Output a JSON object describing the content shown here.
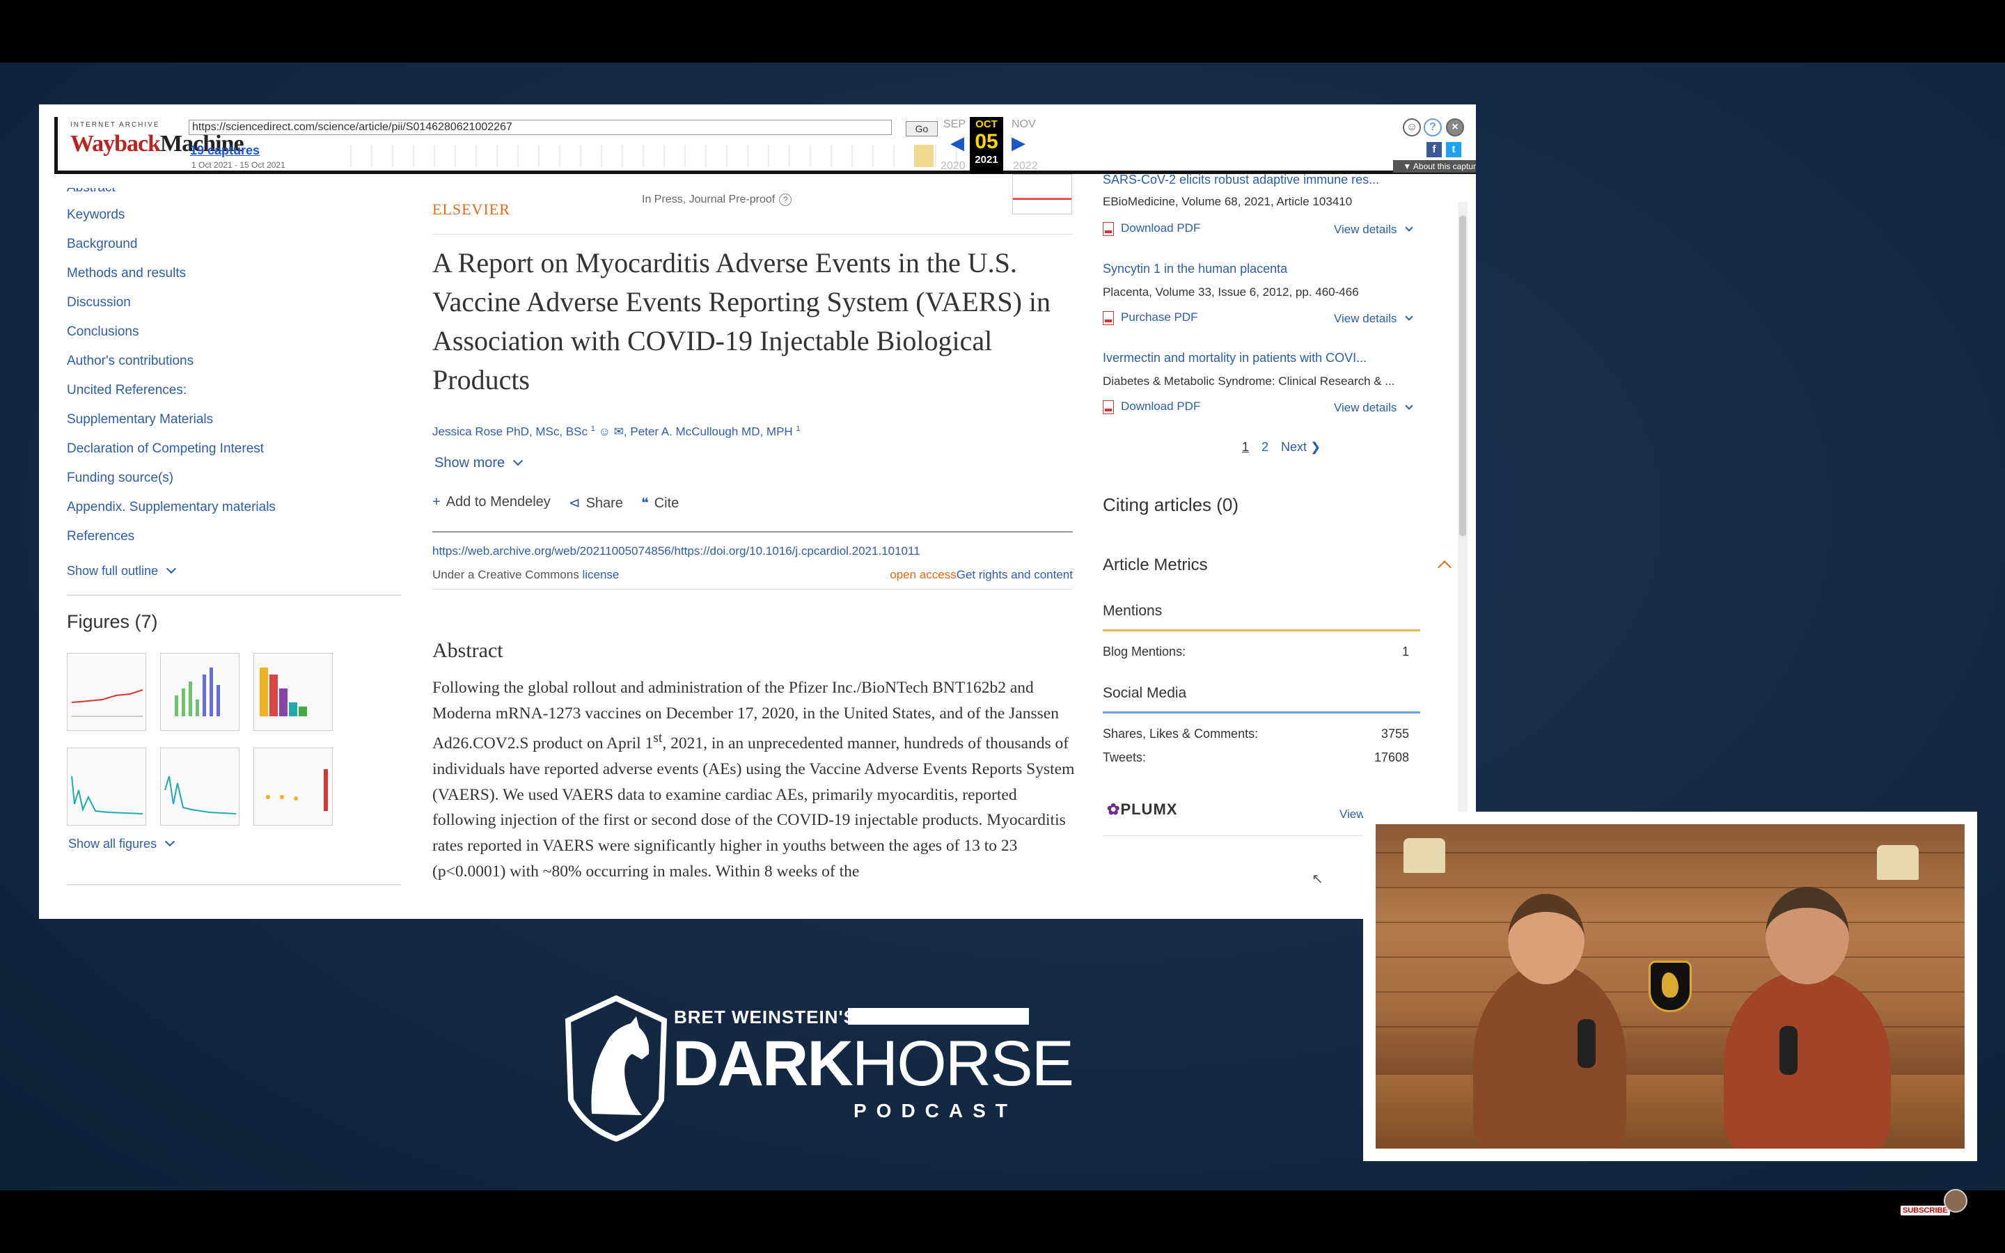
{
  "wayback": {
    "archive_label": "INTERNET ARCHIVE",
    "logo_a": "Wayback",
    "logo_b": "Machine",
    "url": "https://sciencedirect.com/science/article/pii/S0146280621002267",
    "go_label": "Go",
    "captures": "19 captures",
    "range": "1 Oct 2021 - 15 Oct 2021",
    "months": [
      "SEP",
      "OCT",
      "NOV"
    ],
    "day": "05",
    "years": [
      "2020",
      "2021",
      "2022"
    ],
    "about": "▼ About this capture",
    "accent": "#ffd700"
  },
  "outline": {
    "items": [
      "Keywords",
      "Background",
      "Methods and results",
      "Discussion",
      "Conclusions",
      "Author's contributions",
      "Uncited References:",
      "Supplementary Materials",
      "Declaration of Competing Interest",
      "Funding source(s)",
      "Appendix. Supplementary materials",
      "References"
    ],
    "partial_top": "Abstract",
    "show_full": "Show full outline",
    "figures_title": "Figures (7)",
    "show_figures": "Show all figures"
  },
  "article": {
    "publisher": "ELSEVIER",
    "status": "In Press, Journal Pre-proof",
    "title": "A Report on Myocarditis Adverse Events in the U.S. Vaccine Adverse Events Reporting System (VAERS) in Association with COVID-19 Injectable Biological Products",
    "author1": "Jessica Rose PhD, MSc, BSc",
    "author1_sup": "1",
    "author2": "Peter A. McCullough MD, MPH",
    "author2_sup": "1",
    "show_more": "Show more",
    "add_mendeley": "Add to Mendeley",
    "share": "Share",
    "cite": "Cite",
    "doi": "https://web.archive.org/web/20211005074856/https://doi.org/10.1016/j.cpcardiol.2021.101011",
    "license_prefix": "Under a Creative Commons",
    "license_link": "license",
    "open_access": "open access",
    "rights": "Get rights and content",
    "abstract_heading": "Abstract",
    "abstract_p1": "Following the global rollout and administration of the Pfizer Inc./BioNTech BNT162b2 and Moderna mRNA-1273 vaccines on December 17, 2020, in the United States, and of the Janssen Ad26.COV2.S product on April 1",
    "abstract_sup": "st",
    "abstract_p2": ", 2021, in an unprecedented manner, hundreds of thousands of individuals have reported adverse events (AEs) using the Vaccine Adverse Events Reports System (VAERS). We used VAERS data to examine cardiac AEs, primarily myocarditis, reported following injection of the first or second dose of the COVID-19 injectable products. Myocarditis rates reported in VAERS were significantly higher in youths between the ages of 13 to 23 (p<0.0001) with ~80% occurring in males. Within 8 weeks of the"
  },
  "recommended": [
    {
      "title": "SARS-CoV-2 elicits robust adaptive immune res...",
      "source": "EBioMedicine, Volume 68, 2021, Article 103410",
      "pdf": "Download PDF",
      "details": "View details"
    },
    {
      "title": "Syncytin 1 in the human placenta",
      "source": "Placenta, Volume 33, Issue 6, 2012, pp. 460-466",
      "pdf": "Purchase PDF",
      "details": "View details"
    },
    {
      "title": "Ivermectin and mortality in patients with COVI...",
      "source": "Diabetes & Metabolic Syndrome: Clinical Research & ...",
      "pdf": "Download PDF",
      "details": "View details"
    }
  ],
  "pager": {
    "p1": "1",
    "p2": "2",
    "next": "Next"
  },
  "citing": "Citing articles (0)",
  "metrics": {
    "title": "Article Metrics",
    "mentions": "Mentions",
    "blog_label": "Blog Mentions:",
    "blog_value": "1",
    "social": "Social Media",
    "shares_label": "Shares, Likes & Comments:",
    "shares_value": "3755",
    "tweets_label": "Tweets:",
    "tweets_value": "17608",
    "plumx_a": "✿",
    "plumx_b": "PLUMX",
    "view": "View"
  },
  "podcast": {
    "line1": "BRET WEINSTEIN'S",
    "dark": "DARK",
    "horse": "HORSE",
    "podcast": "PODCAST"
  },
  "overlay": {
    "subscribe": "SUBSCRIBE"
  }
}
